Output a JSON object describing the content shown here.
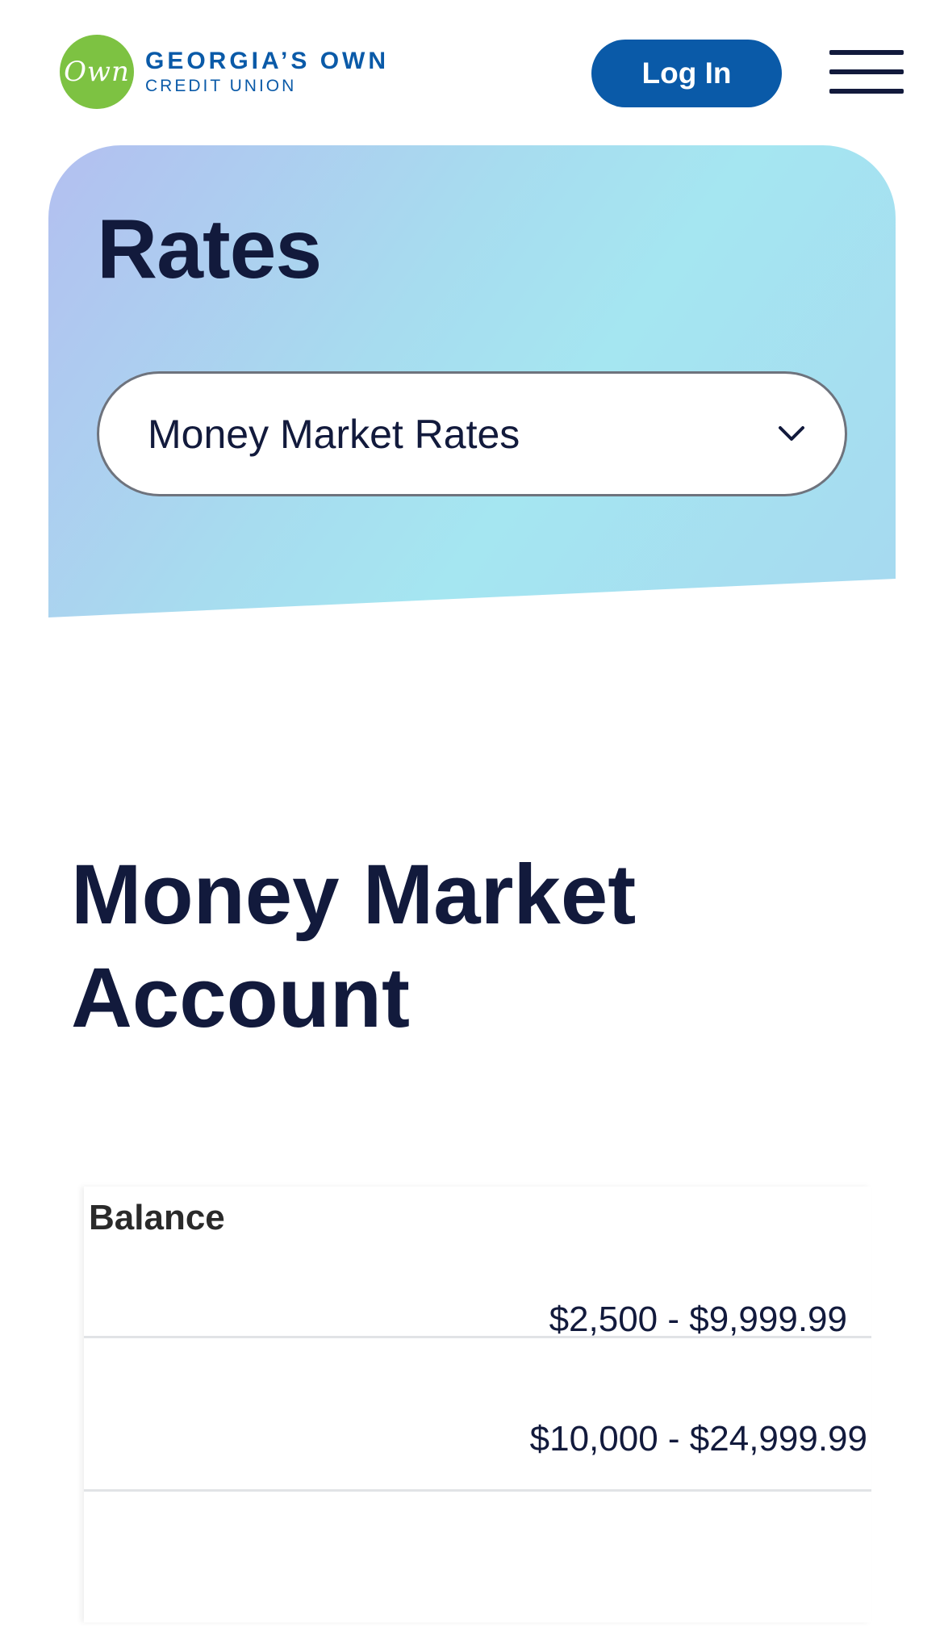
{
  "header": {
    "logo_mark": "Own",
    "logo_line1": "GEORGIA’S OWN",
    "logo_line2": "CREDIT UNION",
    "login_label": "Log In",
    "menu_icon": "hamburger-menu-icon"
  },
  "hero": {
    "title": "Rates",
    "select_value": "Money Market Rates",
    "select_icon": "chevron-down-icon"
  },
  "section": {
    "title": "Money Market Account"
  },
  "table": {
    "header": "Balance",
    "rows": [
      {
        "balance": "$2,500 - $9,999.99"
      },
      {
        "balance": "$10,000 - $24,999.99"
      },
      {
        "balance": ""
      }
    ]
  },
  "colors": {
    "brand_blue": "#0a5aa8",
    "logo_green": "#7dc242",
    "heading_navy": "#121a3c"
  }
}
